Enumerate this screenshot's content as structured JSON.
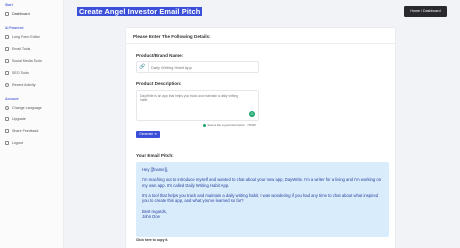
{
  "sidebar": {
    "section_start": "Start",
    "section_ai": "AI Powered",
    "section_account": "Account",
    "items": [
      {
        "label": "Dashboard"
      },
      {
        "label": "Long Form Editor"
      },
      {
        "label": "Email Tools"
      },
      {
        "label": "Social Media Tools"
      },
      {
        "label": "SEO Tools"
      },
      {
        "label": "Recent Activity"
      },
      {
        "label": "Change Language"
      },
      {
        "label": "Upgrade"
      },
      {
        "label": "Share Feedback"
      },
      {
        "label": "Logout"
      }
    ]
  },
  "header": {
    "title": "Create Angel Investor Email Pitch",
    "breadcrumb_button": "Home  /  Dashboard"
  },
  "form": {
    "heading": "Please Enter The Following Details:",
    "brand_label": "Product/Brand Name:",
    "brand_placeholder": "Daily Writing Habit App",
    "desc_label": "Product Description:",
    "desc_value": "DayWrite is an app that helps you track and maintain a daily writing habit.",
    "hint": "Seems like a good description · 75/300",
    "generate_label": "Generate ➜"
  },
  "result": {
    "label": "Your Email Pitch:",
    "paragraphs": [
      "Hey [[fname]],",
      "I'm reaching out to introduce myself and wanted to chat about your new app, DayWrite. I'm a writer for a living and I'm working on my own app. It's called Daily Writing Habit App.",
      "It's a tool that helps you track and maintain a daily writing habit. I was wondering if you had any time to chat about what inspired you to create this app, and what you've learned so far?",
      "Best regards,\nJohn Doe"
    ],
    "copy_hint": "Click here to copy it."
  },
  "colors": {
    "accent": "#3b4fd8",
    "result_bg": "#d9ecfb",
    "result_text": "#2a3e9e",
    "success": "#15a66a"
  }
}
